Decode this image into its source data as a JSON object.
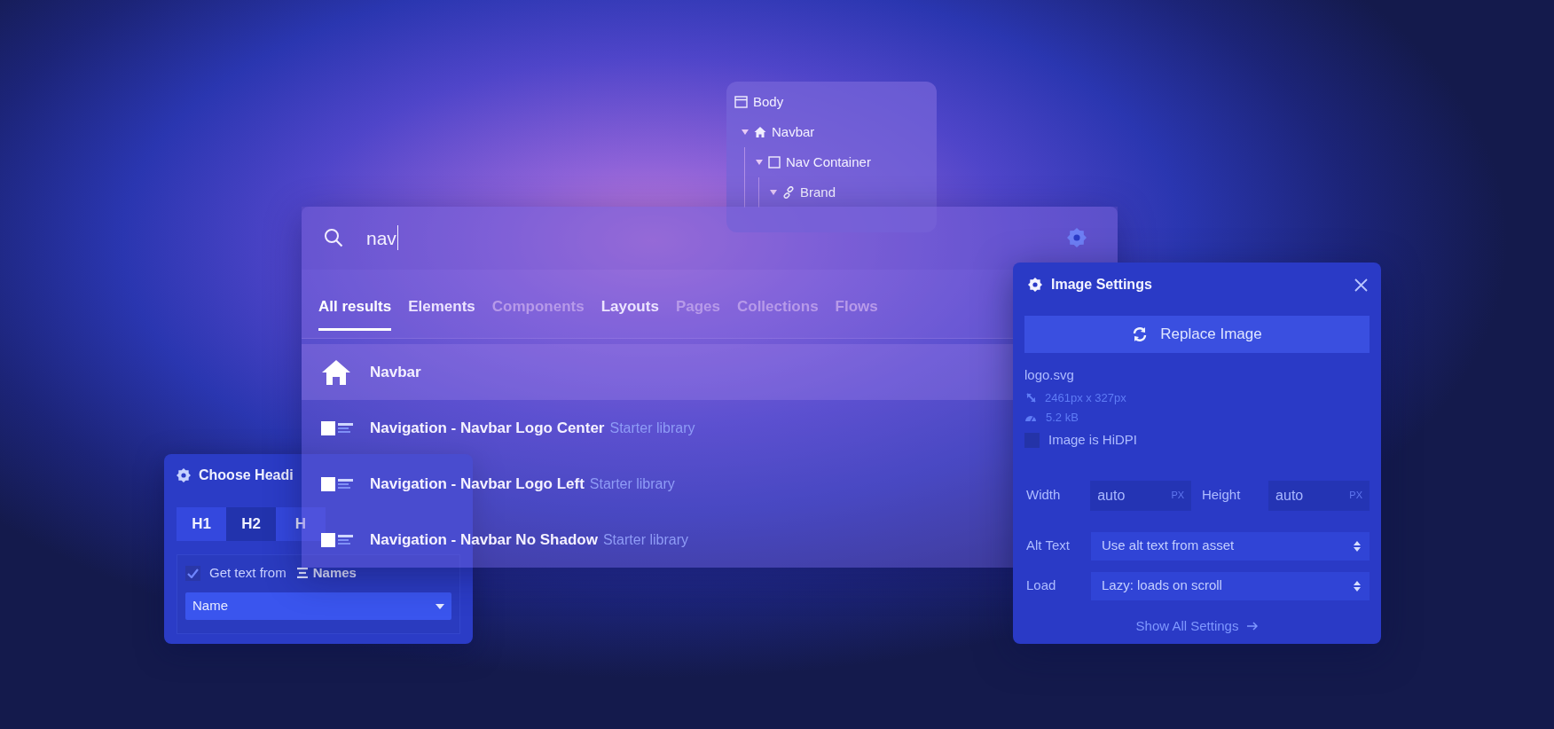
{
  "navigator": {
    "items": [
      {
        "label": "Body",
        "kind": "window",
        "children": [
          {
            "label": "Navbar",
            "kind": "home",
            "expanded": true,
            "children": [
              {
                "label": "Nav Container",
                "kind": "square",
                "expanded": true,
                "children": [
                  {
                    "label": "Brand",
                    "kind": "link",
                    "expanded": true
                  }
                ]
              }
            ]
          }
        ]
      }
    ]
  },
  "search": {
    "value": "nav",
    "tabs": [
      {
        "label": "All results",
        "selected": true,
        "enabled": true
      },
      {
        "label": "Elements",
        "selected": false,
        "enabled": true
      },
      {
        "label": "Components",
        "selected": false,
        "enabled": false
      },
      {
        "label": "Layouts",
        "selected": false,
        "enabled": true
      },
      {
        "label": "Pages",
        "selected": false,
        "enabled": false
      },
      {
        "label": "Collections",
        "selected": false,
        "enabled": false
      },
      {
        "label": "Flows",
        "selected": false,
        "enabled": false
      }
    ],
    "results": [
      {
        "kind": "symbol",
        "title": "Navbar",
        "selected": true
      },
      {
        "kind": "layout",
        "title": "Navigation - Navbar Logo Center",
        "source": "Starter library",
        "selected": false
      },
      {
        "kind": "layout",
        "title": "Navigation - Navbar Logo Left",
        "source": "Starter library",
        "selected": false
      },
      {
        "kind": "layout",
        "title": "Navigation - Navbar No Shadow",
        "source": "Starter library",
        "selected": false
      }
    ]
  },
  "image_settings": {
    "title": "Image Settings",
    "replace_button": "Replace Image",
    "file_name": "logo.svg",
    "dimensions": "2461px x 327px",
    "file_size": "5.2 kB",
    "hidpi": {
      "label": "Image is HiDPI",
      "checked": false
    },
    "width": {
      "label": "Width",
      "value": "auto",
      "unit": "PX"
    },
    "height": {
      "label": "Height",
      "value": "auto",
      "unit": "PX"
    },
    "alt_text": {
      "label": "Alt Text",
      "value": "Use alt text from asset"
    },
    "load": {
      "label": "Load",
      "value": "Lazy: loads on scroll"
    },
    "show_all_link": "Show All Settings"
  },
  "heading_panel": {
    "title": "Choose Headi",
    "levels": [
      {
        "label": "H1",
        "selected": false
      },
      {
        "label": "H2",
        "selected": true
      },
      {
        "label": "H",
        "selected": false
      }
    ],
    "get_text": {
      "label": "Get text from",
      "checked": true,
      "source": "Names"
    },
    "field": {
      "value": "Name"
    }
  }
}
